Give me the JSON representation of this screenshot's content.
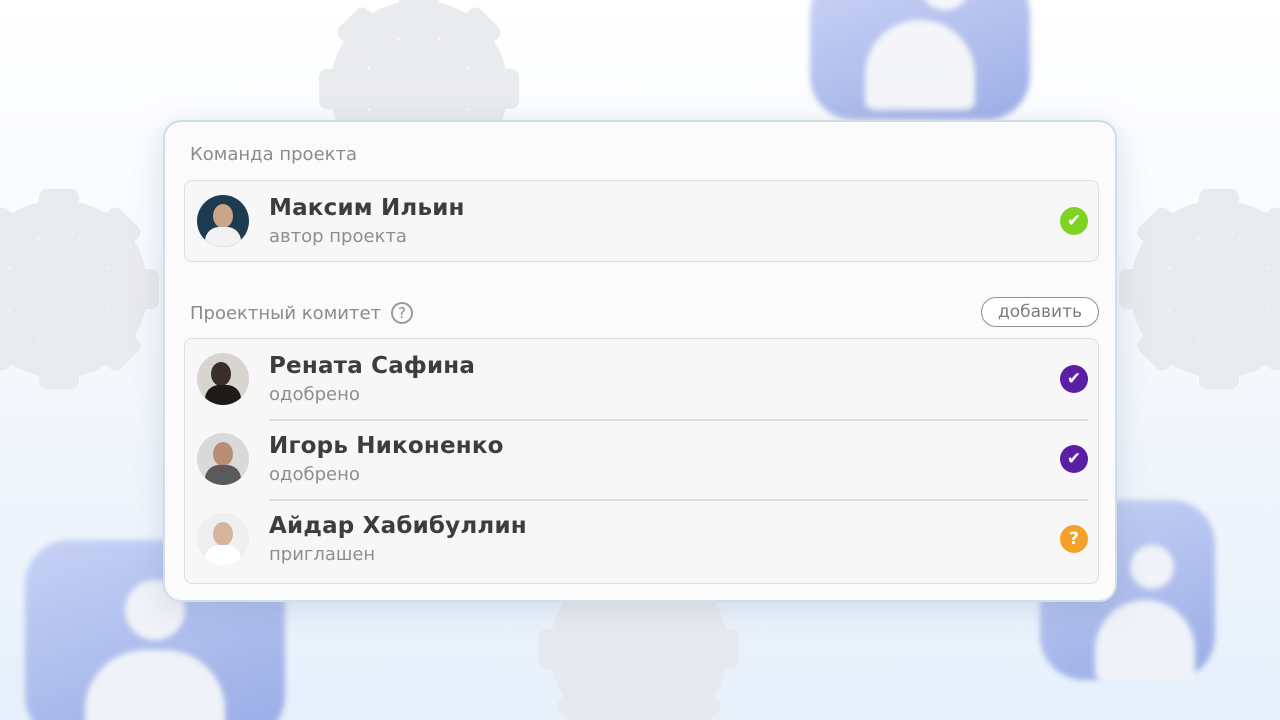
{
  "colors": {
    "approved_author": "#7ed321",
    "approved": "#5b1fa6",
    "pending": "#f5a029",
    "card_border": "#cfdfe6"
  },
  "team": {
    "title": "Команда проекта",
    "author": {
      "name": "Максим Ильин",
      "status": "автор проекта",
      "status_icon": "check-icon"
    }
  },
  "committee": {
    "title": "Проектный комитет",
    "help_icon": "?",
    "add_label": "добавить",
    "members": [
      {
        "name": "Рената Сафина",
        "status": "одобрено",
        "status_icon": "check-icon"
      },
      {
        "name": "Игорь Никоненко",
        "status": "одобрено",
        "status_icon": "check-icon"
      },
      {
        "name": "Айдар Хабибуллин",
        "status": "приглашен",
        "status_icon": "question-icon"
      }
    ]
  },
  "icons": {
    "check": "✔",
    "question": "?"
  }
}
